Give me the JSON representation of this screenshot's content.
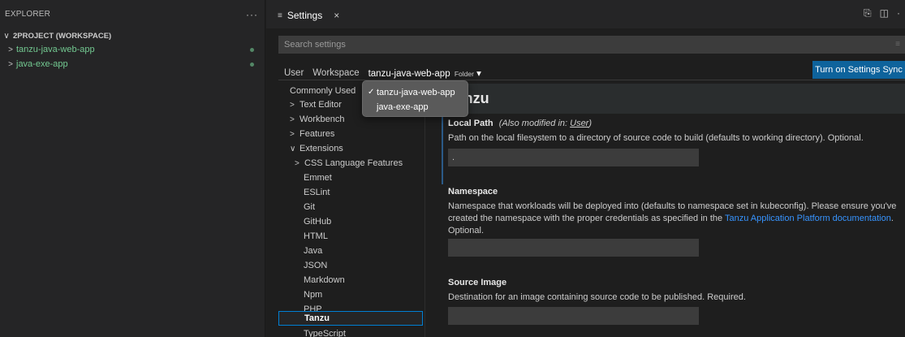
{
  "explorer": {
    "title": "EXPLORER",
    "more": "···",
    "workspace": {
      "chevron": "∨",
      "label": "2PROJECT (WORKSPACE)"
    },
    "folders": [
      {
        "chevron": ">",
        "label": "tanzu-java-web-app"
      },
      {
        "chevron": ">",
        "label": "java-exe-app"
      }
    ]
  },
  "tab": {
    "icon": "≡",
    "label": "Settings",
    "close": "×"
  },
  "tab_actions": {
    "open_json": "⎘",
    "split": "◫",
    "more": "·"
  },
  "search": {
    "placeholder": "Search settings",
    "clear_icon": "≡"
  },
  "scope": {
    "user": "User",
    "workspace": "Workspace",
    "folder": "tanzu-java-web-app",
    "folder_suffix": "Folder",
    "folder_caret": "▾"
  },
  "sync_button": "Turn on Settings Sync",
  "toc": {
    "items": [
      {
        "chevron": "",
        "label": "Commonly Used"
      },
      {
        "chevron": ">",
        "label": "Text Editor"
      },
      {
        "chevron": ">",
        "label": "Workbench"
      },
      {
        "chevron": ">",
        "label": "Features"
      },
      {
        "chevron": "∨",
        "label": "Extensions"
      },
      {
        "chevron": ">",
        "label": "CSS Language Features"
      },
      {
        "chevron": "",
        "label": "Emmet"
      },
      {
        "chevron": "",
        "label": "ESLint"
      },
      {
        "chevron": "",
        "label": "Git"
      },
      {
        "chevron": "",
        "label": "GitHub"
      },
      {
        "chevron": "",
        "label": "HTML"
      },
      {
        "chevron": "",
        "label": "Java"
      },
      {
        "chevron": "",
        "label": "JSON"
      },
      {
        "chevron": "",
        "label": "Markdown"
      },
      {
        "chevron": "",
        "label": "Npm"
      },
      {
        "chevron": "",
        "label": "PHP"
      },
      {
        "chevron": "",
        "label": "Tanzu"
      },
      {
        "chevron": "",
        "label": "TypeScript"
      }
    ],
    "selected": "Tanzu"
  },
  "section": {
    "title": "Tanzu"
  },
  "settings": {
    "local_path": {
      "title": "Local Path",
      "modified_prefix": "(Also modified in: ",
      "modified_link": "User",
      "modified_suffix": ")",
      "description": "Path on the local filesystem to a directory of source code to build (defaults to working directory). Optional.",
      "value": "."
    },
    "namespace": {
      "title": "Namespace",
      "description_1": "Namespace that workloads will be deployed into (defaults to namespace set in kubeconfig). Please ensure you've created the namespace with the proper credentials as specified in the ",
      "link": "Tanzu Application Platform documentation",
      "description_2": ". Optional.",
      "value": ""
    },
    "source_image": {
      "title": "Source Image",
      "description": "Destination for an image containing source code to be published. Required.",
      "value": ""
    }
  },
  "dropdown": {
    "check": "✓",
    "options": [
      "tanzu-java-web-app",
      "java-exe-app"
    ],
    "selected": "tanzu-java-web-app"
  }
}
